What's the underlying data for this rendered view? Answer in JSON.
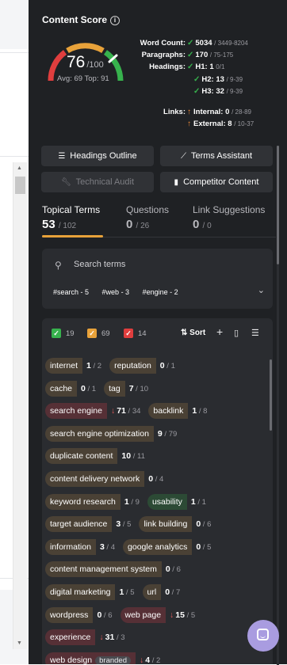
{
  "panel": {
    "title": "Content Score",
    "score": "76",
    "score_max": "/100",
    "avg_top": "Avg: 69 Top: 91"
  },
  "stats": [
    {
      "label": "Word Count:",
      "value": "5034",
      "range": "/ 3449-8204",
      "status": "ok"
    },
    {
      "label": "Paragraphs:",
      "value": "170",
      "range": "/ 75-175",
      "status": "ok"
    },
    {
      "label": "Headings:",
      "sub": [
        {
          "label": "H1:",
          "value": "1",
          "range": "0/1",
          "status": "ok"
        },
        {
          "label": "H2:",
          "value": "13",
          "range": "/ 9-39",
          "status": "ok"
        },
        {
          "label": "H3:",
          "value": "32",
          "range": "/ 9-39",
          "status": "ok"
        }
      ]
    },
    {
      "label": "Links:",
      "sub": [
        {
          "label": "Internal:",
          "value": "0",
          "range": "/ 28-89",
          "status": "up"
        },
        {
          "label": "External:",
          "value": "8",
          "range": "/ 10-37",
          "status": "up"
        }
      ]
    }
  ],
  "tools": {
    "headings_outline": "Headings Outline",
    "terms_assistant": "Terms Assistant",
    "technical_audit": "Technical Audit",
    "competitor_content": "Competitor Content"
  },
  "tabs": [
    {
      "label": "Topical Terms",
      "count": "53",
      "total": "/ 102"
    },
    {
      "label": "Questions",
      "count": "0",
      "total": "/ 26"
    },
    {
      "label": "Link Suggestions",
      "count": "0",
      "total": "/ 0"
    }
  ],
  "search": {
    "placeholder": "Search terms",
    "filters": [
      "#search - 5",
      "#web - 3",
      "#engine - 2"
    ]
  },
  "term_toolbar": {
    "green_count": "19",
    "orange_count": "69",
    "red_count": "14",
    "sort_label": "Sort"
  },
  "terms": [
    [
      {
        "name": "internet",
        "have": "1",
        "target": "2",
        "status": "warn"
      },
      {
        "name": "reputation",
        "have": "0",
        "target": "1",
        "status": "warn"
      }
    ],
    [
      {
        "name": "cache",
        "have": "0",
        "target": "1",
        "status": "warn"
      },
      {
        "name": "tag",
        "have": "7",
        "target": "10",
        "status": "warn"
      }
    ],
    [
      {
        "name": "search engine",
        "have": "71",
        "target": "34",
        "status": "over"
      },
      {
        "name": "backlink",
        "have": "1",
        "target": "8",
        "status": "warn"
      }
    ],
    [
      {
        "name": "search engine optimization",
        "have": "9",
        "target": "79",
        "status": "warn"
      }
    ],
    [
      {
        "name": "duplicate content",
        "have": "10",
        "target": "11",
        "status": "warn"
      }
    ],
    [
      {
        "name": "content delivery network",
        "have": "0",
        "target": "4",
        "status": "warn"
      }
    ],
    [
      {
        "name": "keyword research",
        "have": "1",
        "target": "9",
        "status": "warn"
      },
      {
        "name": "usability",
        "have": "1",
        "target": "1",
        "status": "good"
      }
    ],
    [
      {
        "name": "target audience",
        "have": "3",
        "target": "5",
        "status": "warn"
      },
      {
        "name": "link building",
        "have": "0",
        "target": "6",
        "status": "warn"
      }
    ],
    [
      {
        "name": "information",
        "have": "3",
        "target": "4",
        "status": "warn"
      },
      {
        "name": "google analytics",
        "have": "0",
        "target": "5",
        "status": "warn"
      }
    ],
    [
      {
        "name": "content management system",
        "have": "0",
        "target": "6",
        "status": "warn"
      }
    ],
    [
      {
        "name": "digital marketing",
        "have": "1",
        "target": "5",
        "status": "warn"
      },
      {
        "name": "url",
        "have": "0",
        "target": "7",
        "status": "warn"
      }
    ],
    [
      {
        "name": "wordpress",
        "have": "0",
        "target": "6",
        "status": "warn"
      },
      {
        "name": "web page",
        "have": "15",
        "target": "5",
        "status": "over"
      }
    ],
    [
      {
        "name": "experience",
        "have": "31",
        "target": "3",
        "status": "over"
      }
    ],
    [
      {
        "name": "web design",
        "badge": "branded",
        "have": "4",
        "target": "2",
        "status": "over"
      }
    ]
  ],
  "colors": {
    "accent": "#e8a23a",
    "ok": "#37b24d",
    "warning": "#f08c3a",
    "danger": "#e05a5a",
    "chat": "#a99ce0"
  }
}
